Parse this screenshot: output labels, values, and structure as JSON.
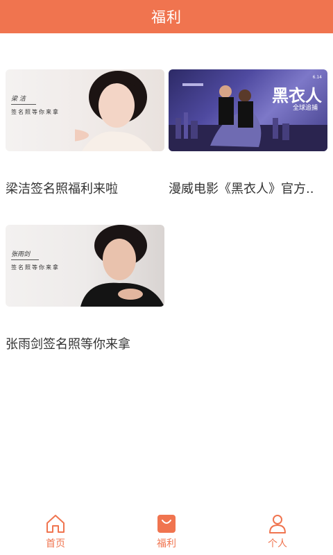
{
  "header": {
    "title": "福利"
  },
  "items": [
    {
      "title": "梁洁签名照福利来啦",
      "thumb": {
        "name": "梁 洁",
        "caption": "签名照等你来拿"
      }
    },
    {
      "title": "漫威电影《黑衣人》官方..",
      "thumb": {
        "poster_title": "黑衣人",
        "poster_sub": "全球追捕"
      }
    },
    {
      "title": "张雨剑签名照等你来拿",
      "thumb": {
        "name": "张雨剑",
        "caption": "签名照等你来拿"
      }
    }
  ],
  "tabs": [
    {
      "label": "首页",
      "icon": "home-icon"
    },
    {
      "label": "福利",
      "icon": "gift-bag-icon",
      "active": true
    },
    {
      "label": "个人",
      "icon": "person-icon"
    }
  ],
  "colors": {
    "accent": "#f0744f"
  }
}
